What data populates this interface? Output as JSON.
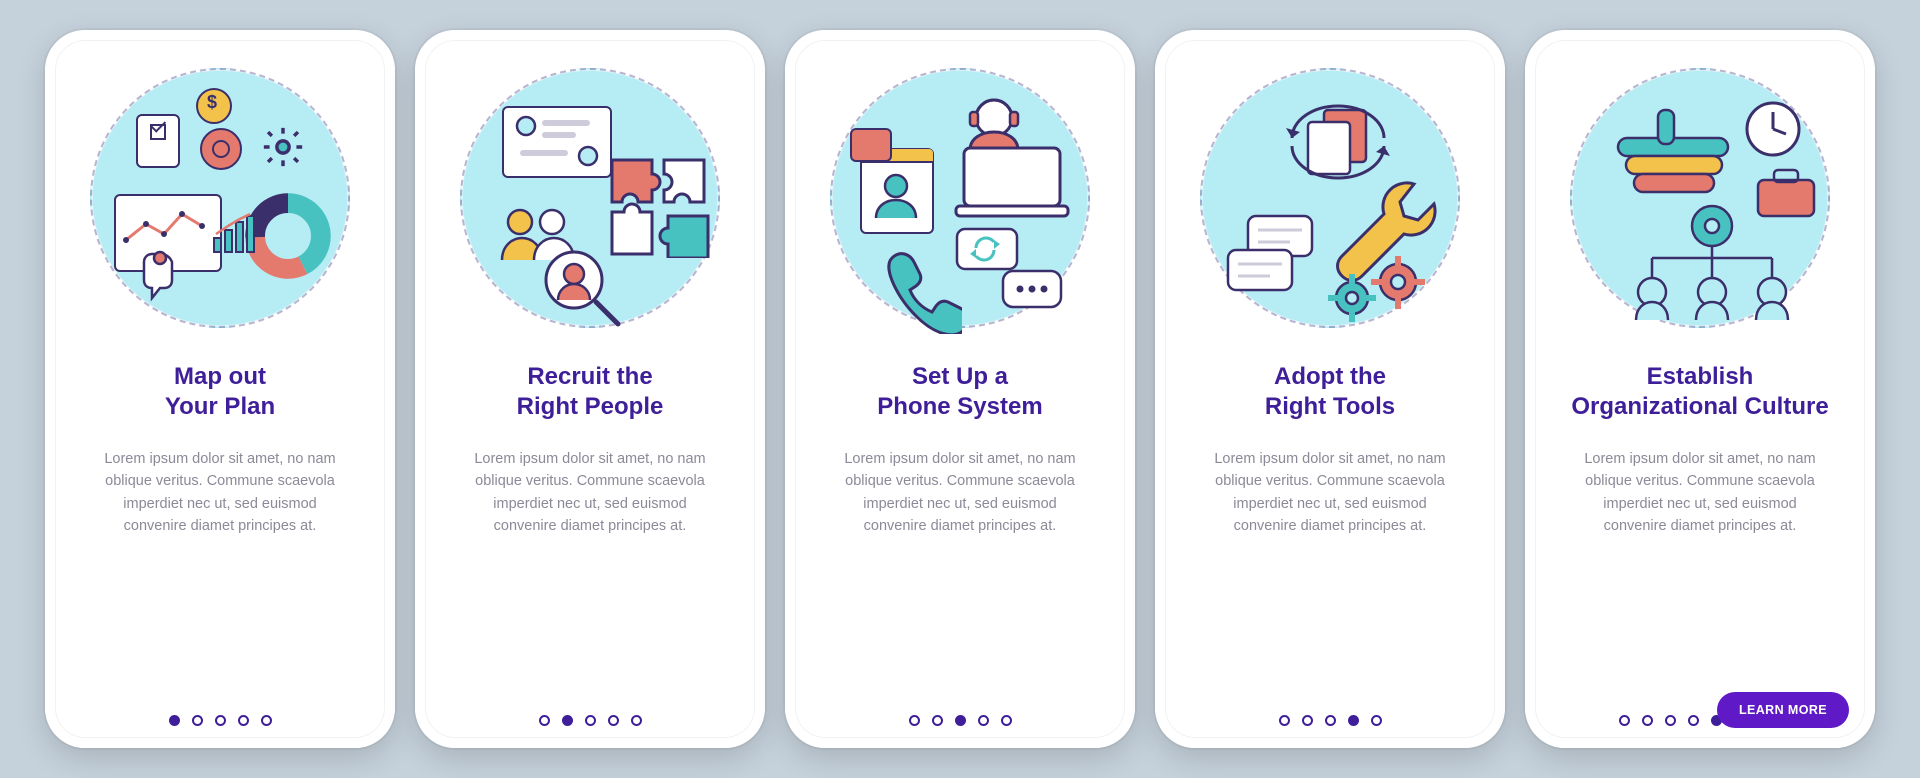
{
  "colors": {
    "page_bg": "#c5d1db",
    "accent_purple": "#3f1f99",
    "cta_bg": "#5f19c7",
    "teal": "#48c2c0",
    "coral": "#e47a6d",
    "yellow": "#f3c24a",
    "icon_stroke": "#3b2f6b"
  },
  "screens": [
    {
      "title": "Map out\nYour Plan",
      "body": "Lorem ipsum dolor sit amet, no nam oblique veritus. Commune scaevola imperdiet nec ut, sed euismod convenire diamet principes at.",
      "icon": "planning-dashboard-icon",
      "active_index": 0,
      "cta": null
    },
    {
      "title": "Recruit the\nRight People",
      "body": "Lorem ipsum dolor sit amet, no nam oblique veritus. Commune scaevola imperdiet nec ut, sed euismod convenire diamet principes at.",
      "icon": "recruit-people-icon",
      "active_index": 1,
      "cta": null
    },
    {
      "title": "Set Up a\nPhone System",
      "body": "Lorem ipsum dolor sit amet, no nam oblique veritus. Commune scaevola imperdiet nec ut, sed euismod convenire diamet principes at.",
      "icon": "phone-system-icon",
      "active_index": 2,
      "cta": null
    },
    {
      "title": "Adopt the\nRight Tools",
      "body": "Lorem ipsum dolor sit amet, no nam oblique veritus. Commune scaevola imperdiet nec ut, sed euismod convenire diamet principes at.",
      "icon": "tools-icon",
      "active_index": 3,
      "cta": null
    },
    {
      "title": "Establish\nOrganizational Culture",
      "body": "Lorem ipsum dolor sit amet, no nam oblique veritus. Commune scaevola imperdiet nec ut, sed euismod convenire diamet principes at.",
      "icon": "org-culture-icon",
      "active_index": 4,
      "cta": "LEARN MORE"
    }
  ],
  "dots_count": 5
}
